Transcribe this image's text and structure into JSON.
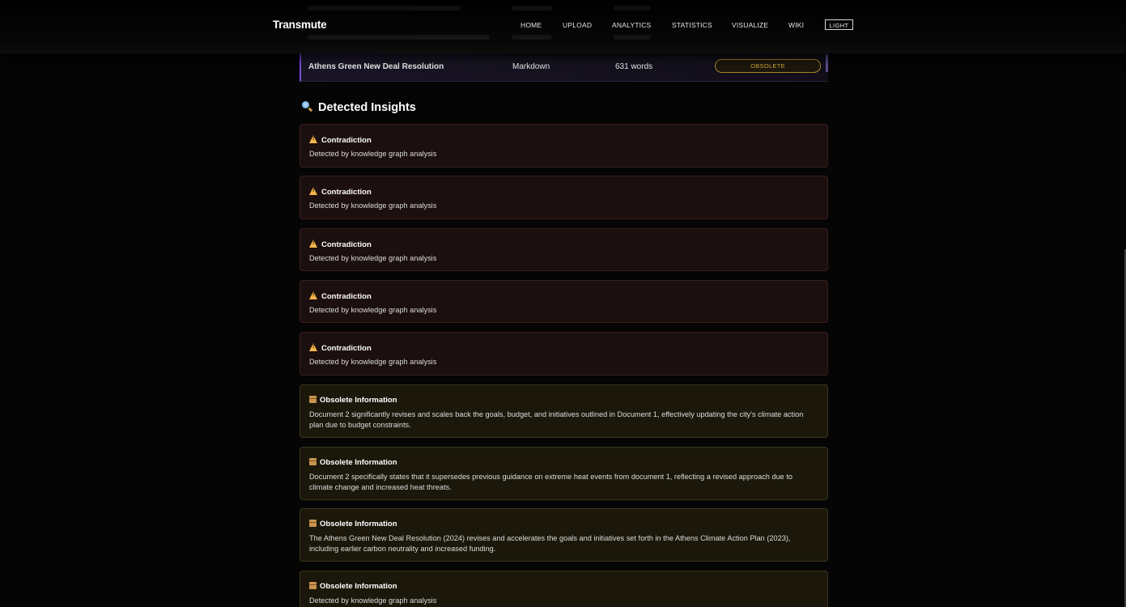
{
  "brand": "Transmute",
  "nav": {
    "items": [
      "HOME",
      "UPLOAD",
      "ANALYTICS",
      "STATISTICS",
      "VISUALIZE",
      "WIKI"
    ],
    "theme_toggle": "LIGHT"
  },
  "document_row": {
    "title": "Athens Green New Deal Resolution",
    "format": "Markdown",
    "word_count": "631 words",
    "status": "OBSOLETE"
  },
  "insights": {
    "heading": "Detected Insights",
    "heading_icon": "magnifier-icon",
    "cards": [
      {
        "kind": "contradiction",
        "icon": "warning-icon",
        "title": "Contradiction",
        "text": "Detected by knowledge graph analysis"
      },
      {
        "kind": "contradiction",
        "icon": "warning-icon",
        "title": "Contradiction",
        "text": "Detected by knowledge graph analysis"
      },
      {
        "kind": "contradiction",
        "icon": "warning-icon",
        "title": "Contradiction",
        "text": "Detected by knowledge graph analysis"
      },
      {
        "kind": "contradiction",
        "icon": "warning-icon",
        "title": "Contradiction",
        "text": "Detected by knowledge graph analysis"
      },
      {
        "kind": "contradiction",
        "icon": "warning-icon",
        "title": "Contradiction",
        "text": "Detected by knowledge graph analysis"
      },
      {
        "kind": "obsolete",
        "icon": "package-icon",
        "title": "Obsolete Information",
        "text": "Document 2 significantly revises and scales back the goals, budget, and initiatives outlined in Document 1, effectively updating the city's climate action plan due to budget constraints."
      },
      {
        "kind": "obsolete",
        "icon": "package-icon",
        "title": "Obsolete Information",
        "text": "Document 2 specifically states that it supersedes previous guidance on extreme heat events from document 1, reflecting a revised approach due to climate change and increased heat threats."
      },
      {
        "kind": "obsolete",
        "icon": "package-icon",
        "title": "Obsolete Information",
        "text": "The Athens Green New Deal Resolution (2024) revises and accelerates the goals and initiatives set forth in the Athens Climate Action Plan (2023), including earlier carbon neutrality and increased funding."
      },
      {
        "kind": "obsolete",
        "icon": "package-icon",
        "title": "Obsolete Information",
        "text": "Detected by knowledge graph analysis"
      }
    ]
  },
  "colors": {
    "background": "#050505",
    "contradiction_card": "#1c0f0f",
    "obsolete_card": "#1b180b",
    "obsolete_badge": "#d4a933",
    "accent_purple": "#7d4fd6"
  }
}
